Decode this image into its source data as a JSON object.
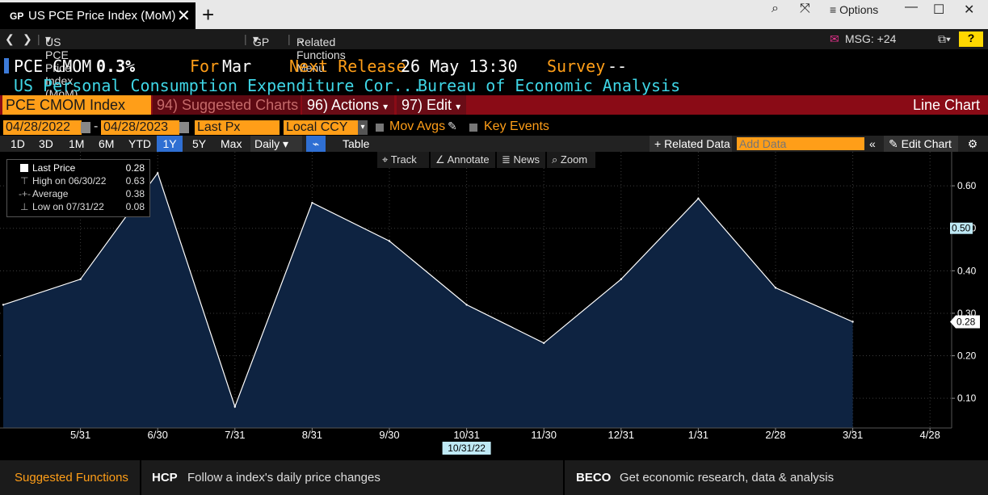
{
  "window": {
    "tab_title": "US PCE Price Index (MoM)",
    "tab_badge": "GP",
    "options_label": "Options"
  },
  "nav": {
    "security": "US PCE Price Index (MoM) Index",
    "function": "GP",
    "related": "Related Functions Menu",
    "msg": "MSG: +24",
    "help": "?"
  },
  "header": {
    "ticker": "PCE CMOM",
    "value": "0.3%",
    "for_label": "For",
    "for_value": "Mar",
    "next_label": "Next Release",
    "next_value": "26 May 13:30",
    "survey_label": "Survey",
    "survey_value": "--",
    "description": "US Personal Consumption Expenditure Cor...",
    "source": "Bureau of Economic Analysis"
  },
  "command_bar": {
    "security_input": "PCE CMOM Index",
    "suggested_num": "94)",
    "suggested_label": "Suggested Charts",
    "actions_num": "96)",
    "actions_label": "Actions",
    "edit_num": "97)",
    "edit_label": "Edit",
    "chart_type": "Line Chart"
  },
  "settings": {
    "start_date": "04/28/2022",
    "end_date": "04/28/2023",
    "field": "Last Px",
    "currency": "Local CCY",
    "mov_avgs": "Mov Avgs",
    "key_events": "Key Events"
  },
  "toolbar": {
    "periods": [
      "1D",
      "3D",
      "1M",
      "6M",
      "YTD",
      "1Y",
      "5Y",
      "Max"
    ],
    "active_period": "1Y",
    "frequency": "Daily",
    "table": "Table",
    "related_data": "+ Related Data",
    "add_data_placeholder": "Add Data",
    "edit_chart": "Edit Chart"
  },
  "chart_tools": {
    "track": "Track",
    "annotate": "Annotate",
    "news": "News",
    "zoom": "Zoom"
  },
  "legend": {
    "last_label": "Last Price",
    "last_value": "0.28",
    "high_label": "High on 06/30/22",
    "high_value": "0.63",
    "avg_label": "Average",
    "avg_value": "0.38",
    "low_label": "Low on 07/31/22",
    "low_value": "0.08"
  },
  "chart_data": {
    "type": "area",
    "x": [
      "4/30/22",
      "5/31/22",
      "6/30/22",
      "7/31/22",
      "8/31/22",
      "9/30/22",
      "10/31/22",
      "11/30/22",
      "12/31/22",
      "1/31/23",
      "2/28/23",
      "3/31/23"
    ],
    "values": [
      0.32,
      0.38,
      0.63,
      0.08,
      0.56,
      0.47,
      0.32,
      0.23,
      0.38,
      0.57,
      0.36,
      0.28
    ],
    "x_tick_labels": [
      "5/31",
      "6/30",
      "7/31",
      "8/31",
      "9/30",
      "10/31",
      "11/30",
      "12/31",
      "1/31",
      "2/28",
      "3/31",
      "4/28"
    ],
    "y_ticks": [
      0.1,
      0.2,
      0.3,
      0.4,
      0.5,
      0.6
    ],
    "ylim": [
      0.03,
      0.68
    ],
    "last_value_label": "0.28",
    "crosshair_y_label": "0.50",
    "crosshair_x_label": "10/31/22",
    "line_color": "#ffffff",
    "fill_color": "#0e2341",
    "grid": true
  },
  "footer": {
    "title": "Suggested Functions",
    "f1_code": "HCP",
    "f1_desc": "Follow a index's daily price changes",
    "f2_code": "BECO",
    "f2_desc": "Get economic research, data & analysis"
  }
}
